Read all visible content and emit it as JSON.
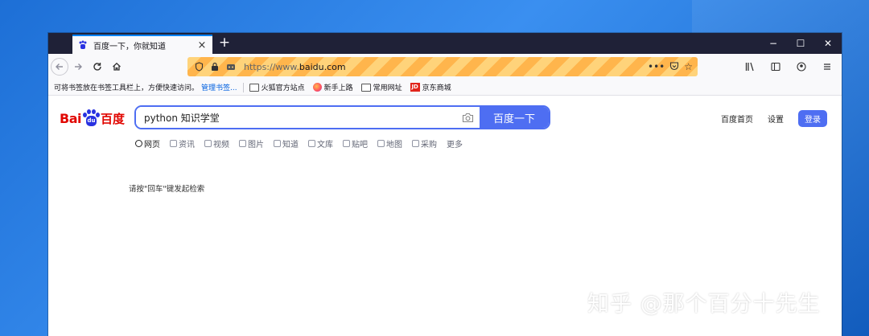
{
  "browser": {
    "tab_title": "百度一下，你就知道",
    "new_tab_label": "+",
    "url_host": "https://www.",
    "url_domain": "baidu.com",
    "window_controls": [
      "−",
      "☐",
      "✕"
    ]
  },
  "bookmarks_bar": {
    "hint": "可将书签放在书签工具栏上，方便快速访问。",
    "manage_link": "管理书签...",
    "items": [
      {
        "label": "火狐官方站点",
        "icon": "folder-icon"
      },
      {
        "label": "新手上路",
        "icon": "firefox-icon"
      },
      {
        "label": "常用网址",
        "icon": "folder-icon"
      },
      {
        "label": "京东商城",
        "icon": "jd-icon"
      }
    ]
  },
  "baidu": {
    "logo_latin": "Bai",
    "logo_du": "du",
    "logo_cn": "百度",
    "search_value": "python 知识学堂",
    "search_button": "百度一下",
    "top_links": [
      "百度首页",
      "设置"
    ],
    "login_label": "登录",
    "tabs": [
      "网页",
      "资讯",
      "视频",
      "图片",
      "知道",
      "文库",
      "贴吧",
      "地图",
      "采购",
      "更多"
    ],
    "hint": "请按\"回车\"键发起检索"
  },
  "watermark": "知乎 @那个百分十先生",
  "colors": {
    "accent": "#4e6ef2",
    "brand_red": "#e10601",
    "urlbar_stripe_1": "#ffd37a",
    "urlbar_stripe_2": "#ffb54c"
  }
}
